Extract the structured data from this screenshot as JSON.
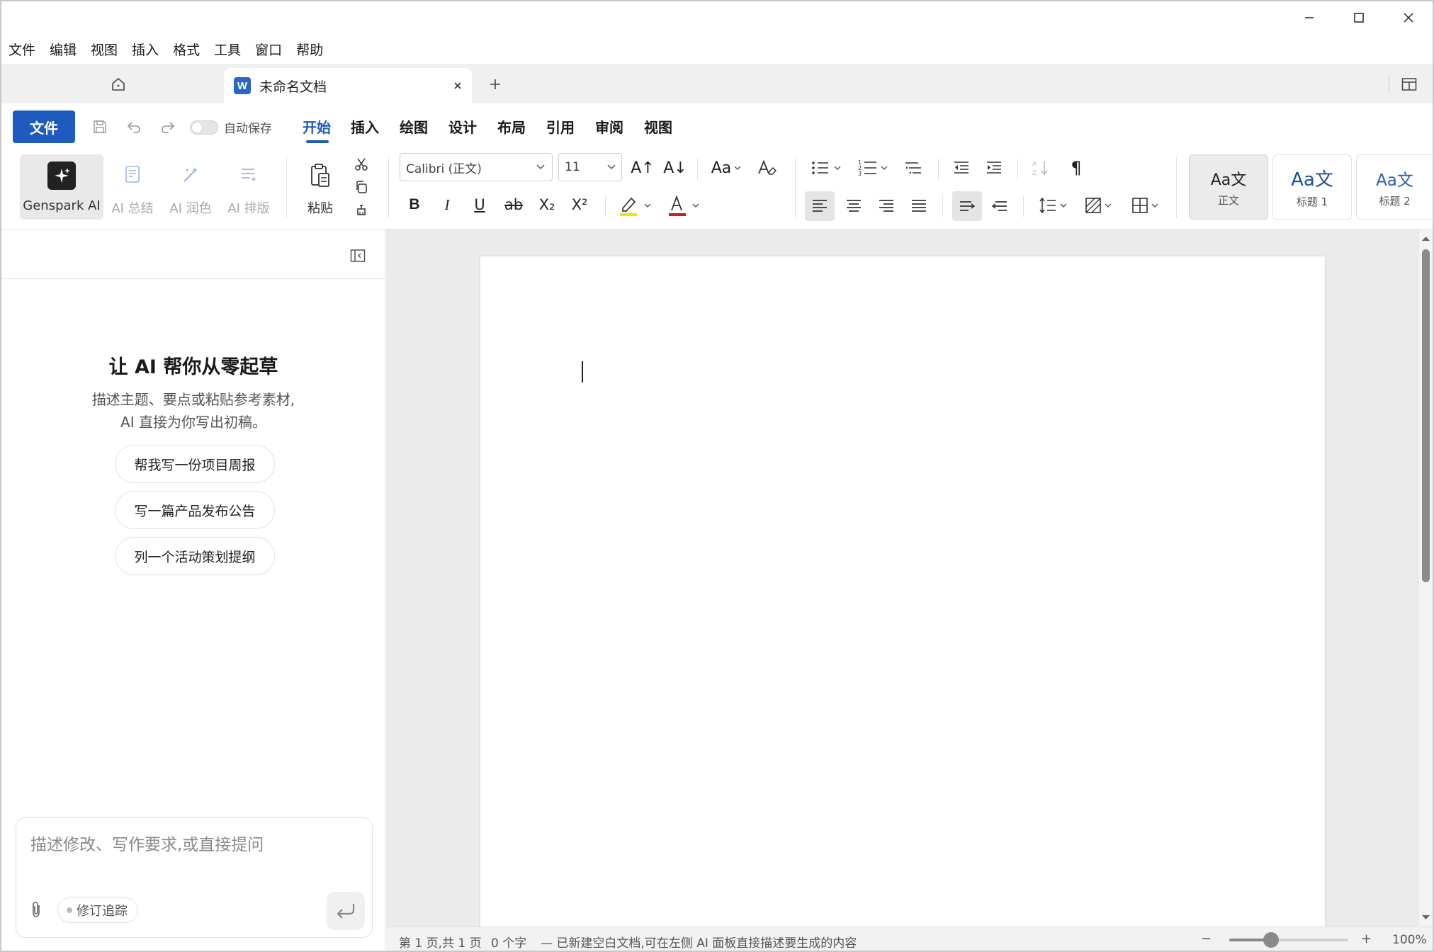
{
  "menubar": {
    "items": [
      "文件",
      "编辑",
      "视图",
      "插入",
      "格式",
      "工具",
      "窗口",
      "帮助"
    ]
  },
  "tabs": {
    "doc_title": "未命名文档",
    "doc_icon": "W"
  },
  "ribbon_tabs": {
    "file": "文件",
    "autosave_label": "自动保存",
    "items": [
      "开始",
      "插入",
      "绘图",
      "设计",
      "布局",
      "引用",
      "审阅",
      "视图"
    ],
    "active": "开始"
  },
  "ribbon": {
    "genspark_ai": "Genspark AI",
    "ai_summary": "AI 总结",
    "ai_polish": "AI 润色",
    "ai_layout": "AI 排版",
    "paste": "粘贴",
    "font_family": "Calibri (正文)",
    "font_size": "11",
    "styles": [
      {
        "sample": "Aa文",
        "name": "正文"
      },
      {
        "sample": "Aa文",
        "name": "标题 1"
      },
      {
        "sample": "Aa文",
        "name": "标题 2"
      }
    ],
    "colors": {
      "highlight": "#f5e500",
      "font_color": "#d11b1b",
      "accent": "#1f5bbf"
    }
  },
  "ai_panel": {
    "heading": "让 AI 帮你从零起草",
    "desc_line1": "描述主题、要点或粘贴参考素材,",
    "desc_line2": "AI 直接为你写出初稿。",
    "suggestions": [
      "帮我写一份项目周报",
      "写一篇产品发布公告",
      "列一个活动策划提纲"
    ],
    "input_placeholder": "描述修改、写作要求,或直接提问",
    "track_changes": "修订追踪"
  },
  "statusbar": {
    "page_info": "第 1 页,共 1 页",
    "word_count": "0 个字",
    "message": "— 已新建空白文档,可在左侧 AI 面板直接描述要生成的内容",
    "zoom_minus": "−",
    "zoom_plus": "+",
    "zoom_level": "100%",
    "zoom_fraction": 0.35
  }
}
